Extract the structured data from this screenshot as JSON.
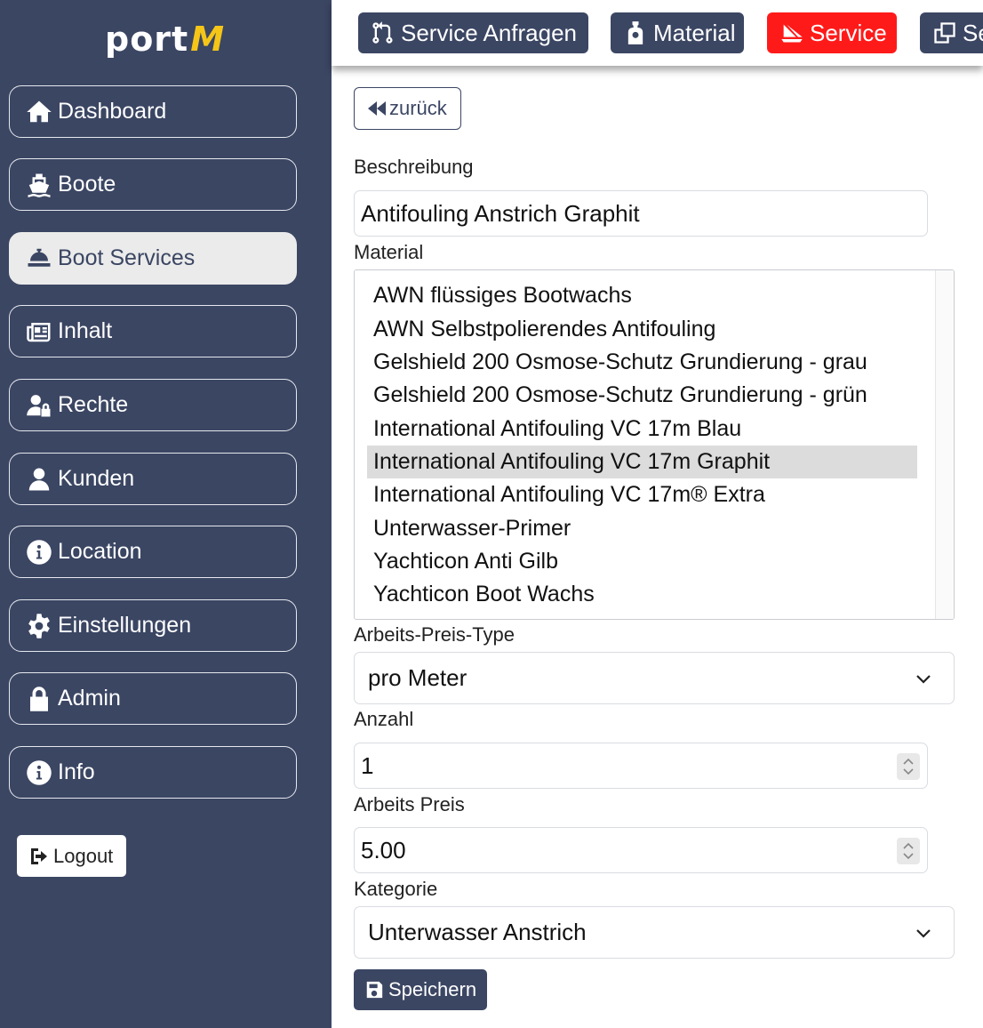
{
  "app": {
    "logo_text": "port",
    "logo_accent": "M",
    "colors": {
      "sidebar": "#3b4663",
      "accent": "#f5c518",
      "danger": "#ff1a1a"
    }
  },
  "sidebar": {
    "items": [
      {
        "label": "Dashboard",
        "icon": "home-icon"
      },
      {
        "label": "Boote",
        "icon": "ship-icon"
      },
      {
        "label": "Boot Services",
        "icon": "bell-concierge-icon",
        "active": true
      },
      {
        "label": "Inhalt",
        "icon": "newspaper-icon"
      },
      {
        "label": "Rechte",
        "icon": "user-lock-icon"
      },
      {
        "label": "Kunden",
        "icon": "user-icon"
      },
      {
        "label": "Location",
        "icon": "info-circle-icon"
      },
      {
        "label": "Einstellungen",
        "icon": "gear-icon"
      },
      {
        "label": "Admin",
        "icon": "lock-icon"
      },
      {
        "label": "Info",
        "icon": "info-circle-icon"
      }
    ],
    "logout_label": "Logout"
  },
  "topbar": {
    "buttons": [
      {
        "label": "Service Anfragen",
        "icon": "code-pull-request-icon"
      },
      {
        "label": "Material",
        "icon": "spray-bottle-icon"
      },
      {
        "label": "Service",
        "icon": "sail-icon"
      },
      {
        "label": "Se",
        "icon": "clone-icon"
      }
    ]
  },
  "form": {
    "back_label": "zurück",
    "beschreibung_label": "Beschreibung",
    "beschreibung_value": "Antifouling Anstrich Graphit",
    "material_label": "Material",
    "material_options": [
      "AWN flüssiges Bootwachs",
      "AWN Selbstpolierendes Antifouling",
      "Gelshield 200 Osmose-Schutz Grundierung - grau",
      "Gelshield 200 Osmose-Schutz Grundierung - grün",
      "International Antifouling VC 17m Blau",
      "International Antifouling VC 17m Graphit",
      "International Antifouling VC 17m® Extra",
      "Unterwasser-Primer",
      "Yachticon Anti Gilb",
      "Yachticon Boot Wachs"
    ],
    "material_selected": "International Antifouling VC 17m Graphit",
    "preis_type_label": "Arbeits-Preis-Type",
    "preis_type_value": "pro Meter",
    "anzahl_label": "Anzahl",
    "anzahl_value": "1",
    "preis_label": "Arbeits Preis",
    "preis_value": "5.00",
    "kategorie_label": "Kategorie",
    "kategorie_value": "Unterwasser Anstrich",
    "save_label": "Speichern"
  }
}
